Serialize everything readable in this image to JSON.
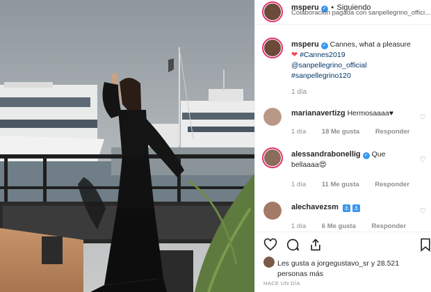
{
  "post_header": {
    "username": "msperu",
    "dot": "•",
    "follow_label": "Siguiendo",
    "subtitle": "Colaboración pagada con sanpellegrino_offici..."
  },
  "caption": {
    "username": "msperu",
    "text": "Cannes, what a pleasure",
    "hashtag": "#Cannes2019",
    "mention": "@sanpellegrino_official",
    "hashtag2": "#sanpellegrino120",
    "time": "1 día"
  },
  "comments": [
    {
      "username": "marianavertizg",
      "text": "Hermosaaaa♥",
      "time": "1 día",
      "likes": "18 Me gusta",
      "reply": "Responder"
    },
    {
      "username": "alessandrabonellig",
      "text": "Que bellaaaa😍",
      "time": "1 día",
      "likes": "11 Me gusta",
      "reply": "Responder"
    },
    {
      "username": "alechavezsm",
      "text": "",
      "time": "1 día",
      "likes": "6 Me gusta",
      "reply": "Responder"
    }
  ],
  "actions": {
    "liked_by_text": "Les gusta a jorgegustavo_sr y 28.521 personas más",
    "time_ago": "HACE UN DÍA"
  },
  "icons": {
    "heart": "heart-icon",
    "comment": "comment-icon",
    "share": "share-icon",
    "bookmark": "bookmark-icon",
    "verified": "verified-badge-icon"
  },
  "colors": {
    "verified": "#3897f0",
    "link": "#003569",
    "meta": "#8e8e8e",
    "heart_red": "#ed4956"
  }
}
